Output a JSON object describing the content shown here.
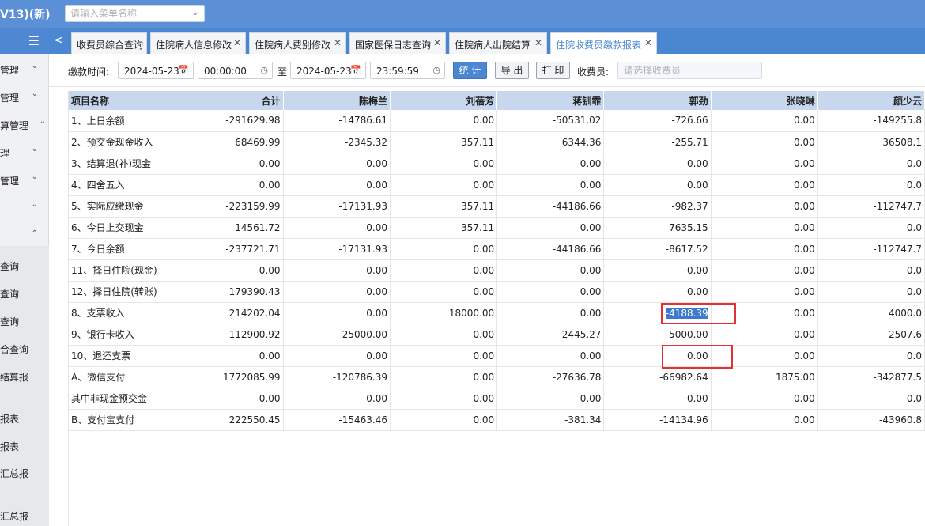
{
  "app": {
    "title": "V13)(新)"
  },
  "menu_search": {
    "placeholder": "请输入菜单名称"
  },
  "sidebar": {
    "groups": [
      {
        "label": "管理"
      },
      {
        "label": "管理"
      },
      {
        "label": "算管理"
      },
      {
        "label": "理"
      },
      {
        "label": "管理"
      },
      {
        "label": ""
      },
      {
        "label": ""
      }
    ],
    "items": [
      {
        "label": "查询"
      },
      {
        "label": "查询"
      },
      {
        "label": "查询"
      },
      {
        "label": "合查询"
      },
      {
        "label": "结算报"
      },
      {
        "label": "报表"
      },
      {
        "label": "报表"
      },
      {
        "label": "汇总报"
      },
      {
        "label": "汇总报"
      }
    ]
  },
  "tabs": [
    {
      "label": "收费员综合查询",
      "closable": false,
      "active": false
    },
    {
      "label": "住院病人信息修改",
      "closable": true,
      "active": false
    },
    {
      "label": "住院病人费别修改",
      "closable": true,
      "active": false
    },
    {
      "label": "国家医保日志查询",
      "closable": true,
      "active": false
    },
    {
      "label": "住院病人出院结算",
      "closable": true,
      "active": false
    },
    {
      "label": "住院收费员缴款报表",
      "closable": true,
      "active": true
    }
  ],
  "filter": {
    "pay_time_label": "缴款时间:",
    "start_date": "2024-05-23",
    "start_time": "00:00:00",
    "to_label": "至",
    "end_date": "2024-05-23",
    "end_time": "23:59:59",
    "stat_button": "统 计",
    "export_button": "导 出",
    "print_button": "打 印",
    "cashier_label": "收费员:",
    "cashier_placeholder": "请选择收费员"
  },
  "table": {
    "columns": [
      "项目名称",
      "合计",
      "陈梅兰",
      "刘蓓芳",
      "蒋钏霏",
      "郭劲",
      "张晓琳",
      "颜少云"
    ],
    "rows": [
      [
        "1、上日余额",
        "-291629.98",
        "-14786.61",
        "0.00",
        "-50531.02",
        "-726.66",
        "0.00",
        "-149255.8"
      ],
      [
        "2、预交金现金收入",
        "68469.99",
        "-2345.32",
        "357.11",
        "6344.36",
        "-255.71",
        "0.00",
        "36508.1"
      ],
      [
        "3、结算退(补)现金",
        "0.00",
        "0.00",
        "0.00",
        "0.00",
        "0.00",
        "0.00",
        "0.0"
      ],
      [
        "4、四舍五入",
        "0.00",
        "0.00",
        "0.00",
        "0.00",
        "0.00",
        "0.00",
        "0.0"
      ],
      [
        "5、实际应缴现金",
        "-223159.99",
        "-17131.93",
        "357.11",
        "-44186.66",
        "-982.37",
        "0.00",
        "-112747.7"
      ],
      [
        "6、今日上交现金",
        "14561.72",
        "0.00",
        "357.11",
        "0.00",
        "7635.15",
        "0.00",
        "0.0"
      ],
      [
        "7、今日余额",
        "-237721.71",
        "-17131.93",
        "0.00",
        "-44186.66",
        "-8617.52",
        "0.00",
        "-112747.7"
      ],
      [
        "11、择日住院(现金)",
        "0.00",
        "0.00",
        "0.00",
        "0.00",
        "0.00",
        "0.00",
        "0.0"
      ],
      [
        "12、择日住院(转账)",
        "179390.43",
        "0.00",
        "0.00",
        "0.00",
        "0.00",
        "0.00",
        "0.0"
      ],
      [
        "8、支票收入",
        "214202.04",
        "0.00",
        "18000.00",
        "0.00",
        "-4188.39",
        "0.00",
        "4000.0"
      ],
      [
        "9、银行卡收入",
        "112900.92",
        "25000.00",
        "0.00",
        "2445.27",
        "-5000.00",
        "0.00",
        "2507.6"
      ],
      [
        "10、退还支票",
        "0.00",
        "0.00",
        "0.00",
        "0.00",
        "0.00",
        "0.00",
        "0.0"
      ],
      [
        "A、微信支付",
        "1772085.99",
        "-120786.39",
        "0.00",
        "-27636.78",
        "-66982.64",
        "1875.00",
        "-342877.5"
      ],
      [
        "其中非现金预交金",
        "0.00",
        "0.00",
        "0.00",
        "0.00",
        "0.00",
        "0.00",
        "0.0"
      ],
      [
        "B、支付宝支付",
        "222550.45",
        "-15463.46",
        "0.00",
        "-381.34",
        "-14134.96",
        "0.00",
        "-43960.8"
      ]
    ],
    "selected_cell": {
      "row": 9,
      "col": 5
    }
  },
  "colors": {
    "topbar": "#5b8fd6",
    "tabbar": "#4b86d1",
    "header": "#c7d7ee",
    "highlight_box": "#e03232"
  },
  "icons": [
    "chevron-down-icon",
    "hamburger-icon",
    "back-arrow-icon",
    "close-icon",
    "calendar-icon",
    "clock-icon"
  ]
}
